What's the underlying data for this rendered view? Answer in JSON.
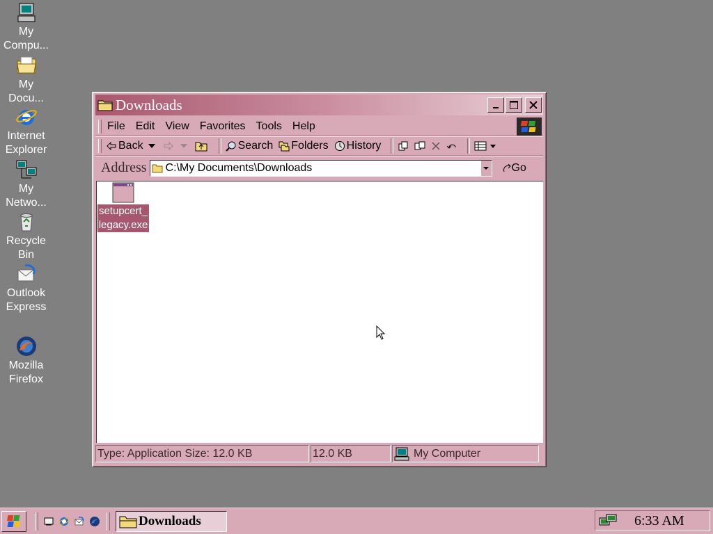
{
  "desktop": {
    "icons": [
      {
        "label": "My Compu...",
        "icon": "my-computer-icon"
      },
      {
        "label": "My Docu...",
        "icon": "my-documents-icon"
      },
      {
        "label": "Internet Explorer",
        "icon": "internet-explorer-icon"
      },
      {
        "label": "My Netwo...",
        "icon": "network-icon"
      },
      {
        "label": "Recycle Bin",
        "icon": "recycle-bin-icon"
      },
      {
        "label": "Outlook Express",
        "icon": "outlook-express-icon"
      },
      {
        "label": "Mozilla Firefox",
        "icon": "firefox-icon"
      }
    ]
  },
  "window": {
    "title": "Downloads",
    "menu": [
      "File",
      "Edit",
      "View",
      "Favorites",
      "Tools",
      "Help"
    ],
    "toolbar": {
      "back": "Back",
      "search": "Search",
      "folders": "Folders",
      "history": "History"
    },
    "address": {
      "label": "Address",
      "value": "C:\\My Documents\\Downloads",
      "go": "Go"
    },
    "files": [
      {
        "name": "setupcert_legacy.exe",
        "selected": true
      }
    ],
    "status": {
      "info": "Type: Application Size: 12.0 KB",
      "size": "12.0 KB",
      "zone": "My Computer"
    }
  },
  "taskbar": {
    "task_label": "Downloads",
    "clock": "6:33 AM"
  },
  "colors": {
    "desktop": "#808080",
    "chrome": "#d8a9b7",
    "title_active": "#a8586e",
    "selection": "#a8586e"
  }
}
